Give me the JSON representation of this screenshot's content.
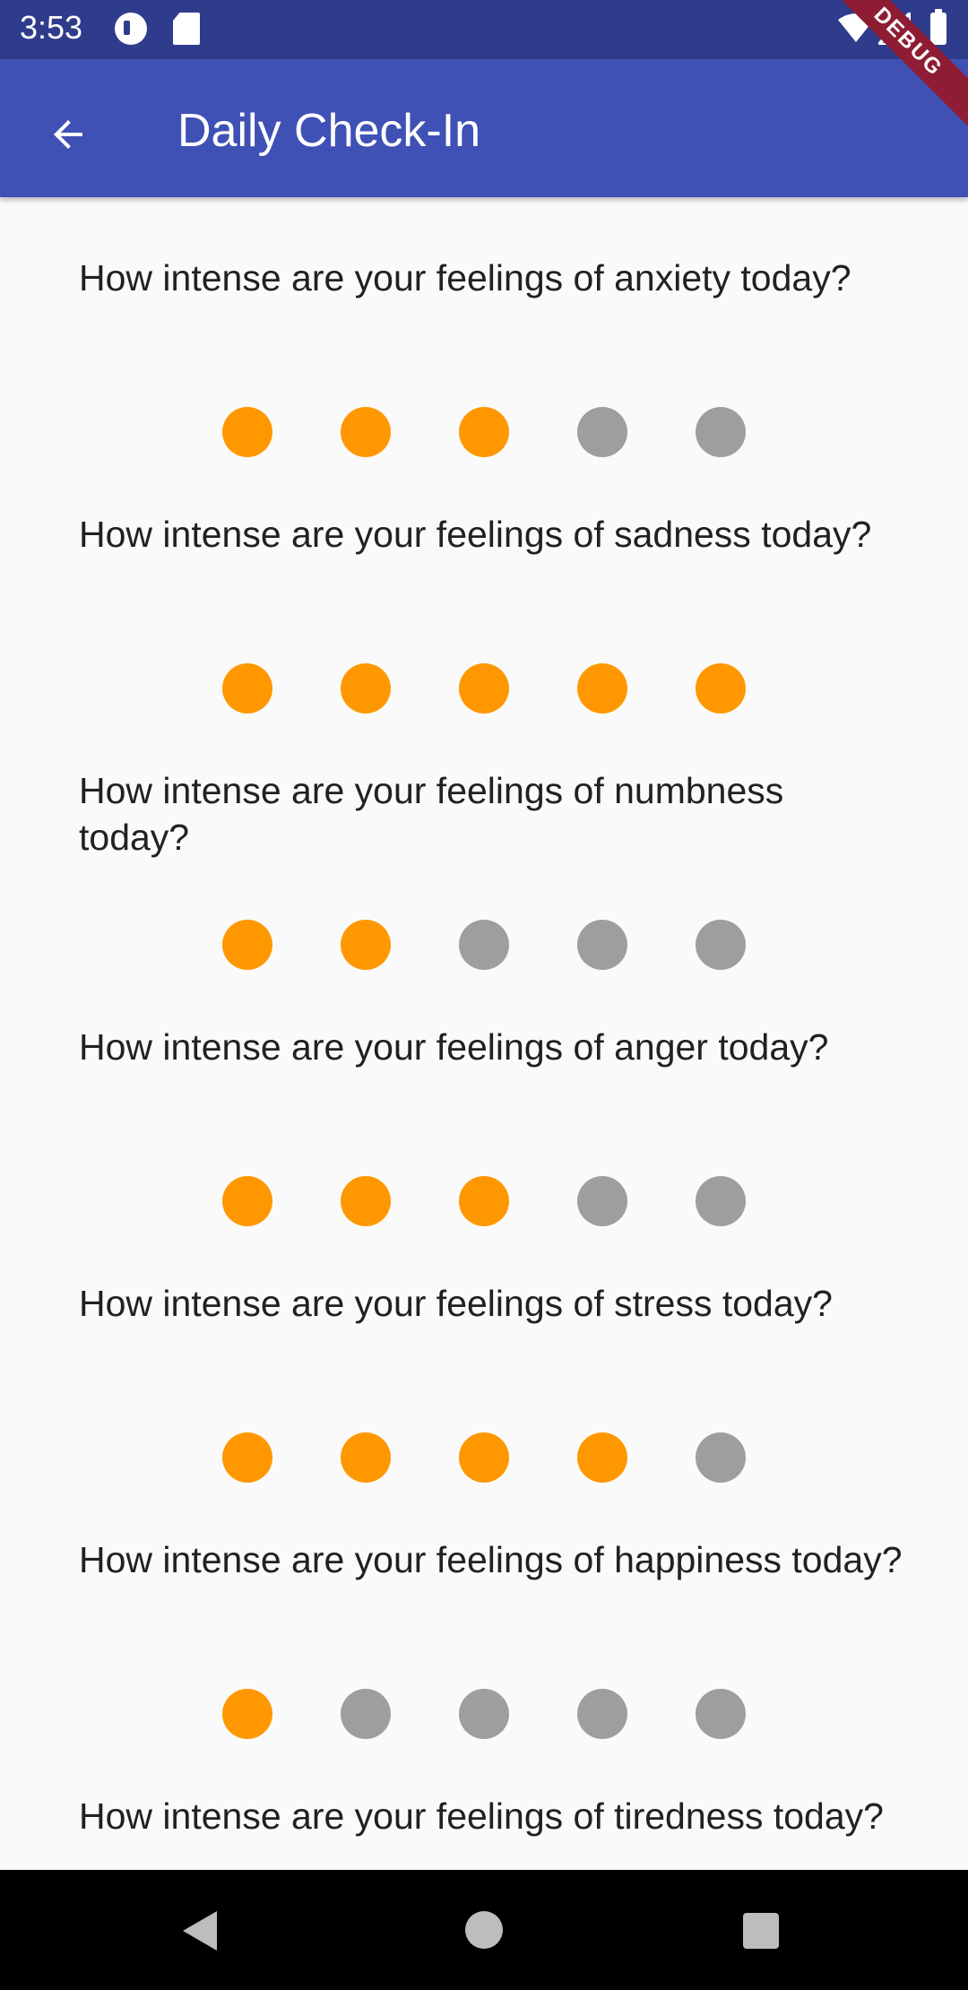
{
  "status_bar": {
    "time": "3:53",
    "icons": [
      "app-notification-icon",
      "sd-card-icon",
      "wifi-icon",
      "signal-icon",
      "battery-icon"
    ]
  },
  "app_bar": {
    "title": "Daily Check-In",
    "back_icon": "arrow-back-icon",
    "background": "#3f51b5"
  },
  "debug_banner": "DEBUG",
  "colors": {
    "dot_selected": "#ff9800",
    "dot_unselected": "#9e9e9e"
  },
  "questions": [
    {
      "text": "How intense are your feelings of anxiety today?",
      "rating": 3,
      "max": 5
    },
    {
      "text": "How intense are your feelings of sadness today?",
      "rating": 5,
      "max": 5
    },
    {
      "text": "How intense are your feelings of numbness today?",
      "rating": 2,
      "max": 5
    },
    {
      "text": "How intense are your feelings of anger today?",
      "rating": 3,
      "max": 5
    },
    {
      "text": "How intense are your feelings of stress today?",
      "rating": 4,
      "max": 5
    },
    {
      "text": "How intense are your feelings of happiness today?",
      "rating": 1,
      "max": 5
    },
    {
      "text": "How intense are your feelings of tiredness today?",
      "rating": null,
      "max": 5
    }
  ],
  "nav_bar": {
    "buttons": [
      "nav-back-icon",
      "nav-home-icon",
      "nav-recents-icon"
    ]
  }
}
